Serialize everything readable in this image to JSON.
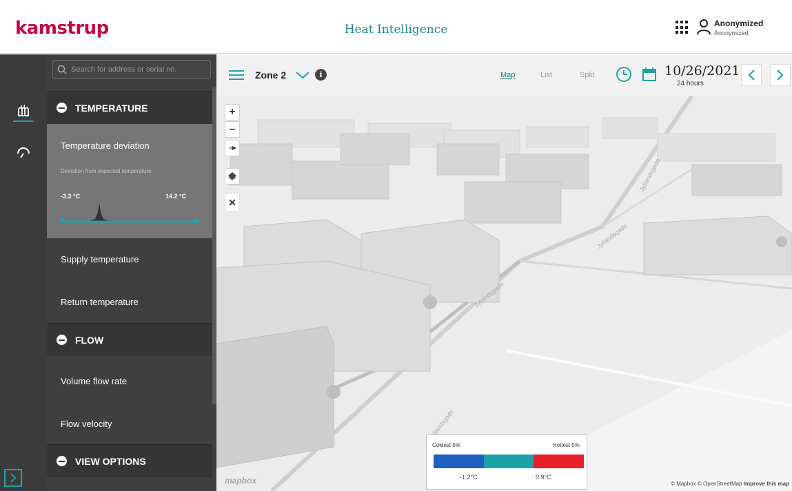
{
  "header": {
    "logo": "kamstrup",
    "title": "Heat Intelligence",
    "user_name": "Anonymized",
    "user_sub": "Anonymized"
  },
  "search": {
    "placeholder": "Search for address or serial no."
  },
  "sidebar": {
    "temperature": {
      "title": "TEMPERATURE",
      "selected": {
        "label": "Temperature deviation",
        "description": "Deviation from expected temperature",
        "min": "-3.3 °C",
        "max": "14.2 °C"
      },
      "items": [
        "Supply temperature",
        "Return temperature"
      ]
    },
    "flow": {
      "title": "FLOW",
      "items": [
        "Volume flow rate",
        "Flow velocity"
      ]
    },
    "view_options": {
      "title": "VIEW OPTIONS"
    }
  },
  "toolbar": {
    "zone": "Zone 2",
    "views": [
      {
        "label": "Map",
        "active": true
      },
      {
        "label": "List",
        "active": false
      },
      {
        "label": "Split",
        "active": false
      }
    ],
    "date": "10/26/2021",
    "period": "24 hours"
  },
  "map": {
    "streets": [
      "Jyllandsgade",
      "Jyllandsgade",
      "Jyllandsgade",
      "Jyllandsgade"
    ],
    "legend": {
      "coldest": "Coldest 5%",
      "hottest": "Hottest 5%",
      "low_value": "-1.2°C",
      "high_value": "0.9°C",
      "colors": [
        "#1e5fbf",
        "#1aa3a6",
        "#e62028"
      ]
    },
    "mapbox_logo": "mapbox",
    "attribution": "© Mapbox © OpenStreetMap",
    "improve": "Improve this map"
  },
  "colors": {
    "accent": "#1fa3a8",
    "brand": "#c8004b"
  }
}
